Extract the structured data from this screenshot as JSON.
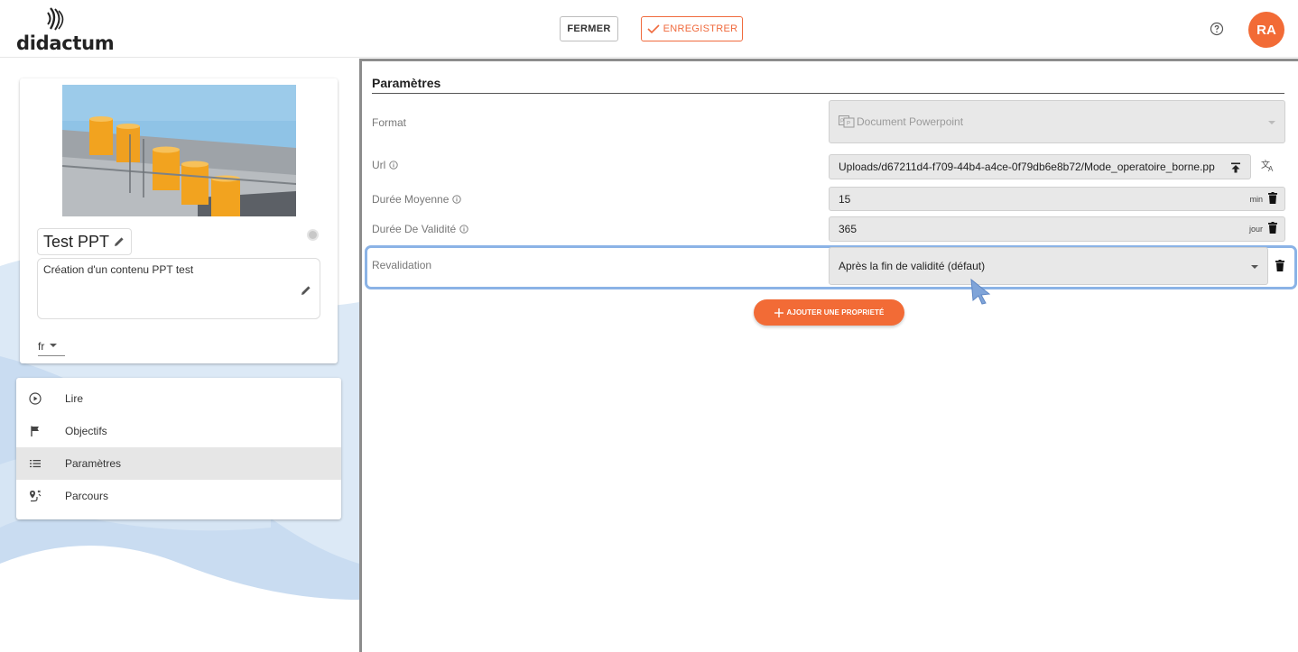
{
  "header": {
    "logo_text": "didactum",
    "close_label": "FERMER",
    "save_label": "ENREGISTRER",
    "avatar_initials": "RA",
    "help_icon": "help-circle-icon"
  },
  "content_card": {
    "title": "Test PPT",
    "description": "Création d'un contenu PPT test",
    "language": "fr"
  },
  "nav": {
    "items": [
      {
        "label": "Lire",
        "icon": "play-circle-icon",
        "active": false
      },
      {
        "label": "Objectifs",
        "icon": "flag-icon",
        "active": false
      },
      {
        "label": "Paramètres",
        "icon": "list-icon",
        "active": true
      },
      {
        "label": "Parcours",
        "icon": "route-icon",
        "active": false
      }
    ]
  },
  "params": {
    "section_title": "Paramètres",
    "rows": [
      {
        "label": "Format",
        "value": "Document Powerpoint"
      },
      {
        "label": "Url",
        "value": "Uploads/d67211d4-f709-44b4-a4ce-0f79db6e8b72/Mode_operatoire_borne.pp"
      },
      {
        "label": "Durée Moyenne",
        "value": "15",
        "unit": "min"
      },
      {
        "label": "Durée De Validité",
        "value": "365",
        "unit": "jour"
      },
      {
        "label": "Revalidation",
        "value": "Après la fin de validité (défaut)"
      }
    ],
    "add_button": "AJOUTER UNE PROPRIETÉ"
  },
  "colors": {
    "accent": "#f26b36",
    "highlight": "#8bb3e6"
  }
}
